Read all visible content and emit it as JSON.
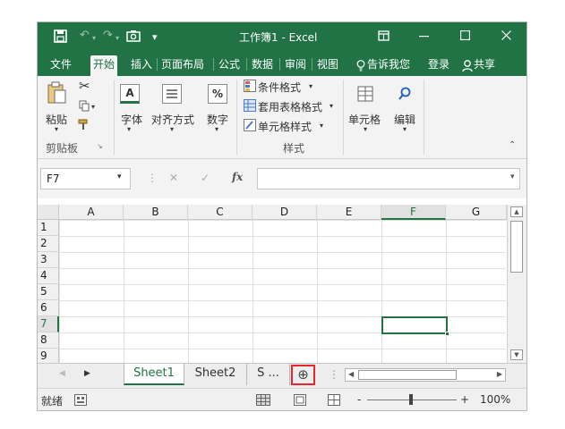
{
  "quick_access": {
    "save_icon": "save-icon",
    "undo_icon": "undo-icon",
    "redo_icon": "redo-icon",
    "camera_icon": "camera-icon",
    "customize_icon": "customize-icon"
  },
  "window": {
    "title": "工作簿1 - Excel",
    "ribbon_display_icon": "ribbon-display-icon",
    "min_icon": "minimize-icon",
    "max_icon": "maximize-icon",
    "close_icon": "close-icon"
  },
  "menu": {
    "tabs": [
      "文件",
      "开始",
      "插入",
      "页面布局",
      "公式",
      "数据",
      "审阅",
      "视图"
    ],
    "active": "开始",
    "tell_me": "告诉我您",
    "login": "登录",
    "share": "共享"
  },
  "ribbon": {
    "clipboard": {
      "paste": "粘贴",
      "group": "剪贴板"
    },
    "font": "字体",
    "alignment": "对齐方式",
    "number": "数字",
    "number_symbol": "%",
    "font_symbol": "A",
    "styles": {
      "conditional": "条件格式",
      "table": "套用表格格式",
      "cell_styles": "单元格样式",
      "group": "样式"
    },
    "cells": "单元格",
    "editing": "编辑"
  },
  "formula_bar": {
    "name_box": "F7",
    "cancel": "✕",
    "enter": "✓",
    "fx": "fx",
    "value": ""
  },
  "sheet": {
    "columns": [
      "A",
      "B",
      "C",
      "D",
      "E",
      "F",
      "G"
    ],
    "rows": [
      "1",
      "2",
      "3",
      "4",
      "5",
      "6",
      "7",
      "8",
      "9"
    ],
    "selected_column": "F",
    "selected_row": "7"
  },
  "tabs": {
    "sheets": [
      "Sheet1",
      "Sheet2",
      "S ..."
    ],
    "active": "Sheet1",
    "add": "⊕"
  },
  "status": {
    "ready": "就绪",
    "zoom": "100%",
    "minus": "-",
    "plus": "+"
  },
  "colors": {
    "excel_green": "#217346",
    "highlight_red": "#e8262d"
  }
}
